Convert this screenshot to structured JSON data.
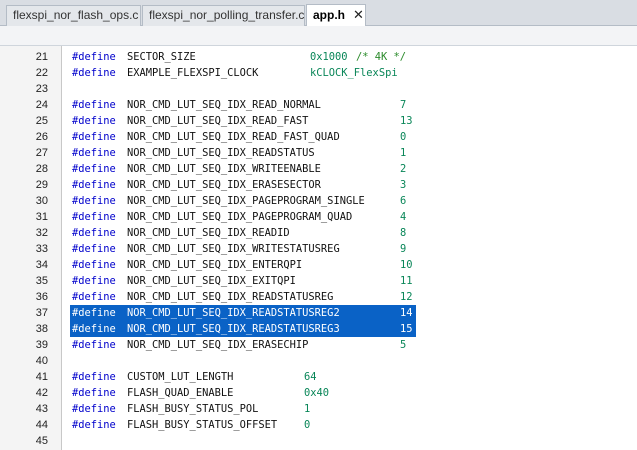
{
  "tabs": [
    {
      "label": "flexspi_nor_flash_ops.c"
    },
    {
      "label": "flexspi_nor_polling_transfer.c"
    },
    {
      "label": "app.h",
      "close": "✕"
    }
  ],
  "code": {
    "lines": [
      {
        "num": "21",
        "kw": "#define",
        "name": "SECTOR_SIZE",
        "value": "0x1000",
        "comment": "/* 4K */"
      },
      {
        "num": "22",
        "kw": "#define",
        "name": "EXAMPLE_FLEXSPI_CLOCK",
        "value": "kCLOCK_FlexSpi"
      },
      {
        "num": "23"
      },
      {
        "num": "24",
        "kw": "#define",
        "name": "NOR_CMD_LUT_SEQ_IDX_READ_NORMAL",
        "value": "7"
      },
      {
        "num": "25",
        "kw": "#define",
        "name": "NOR_CMD_LUT_SEQ_IDX_READ_FAST",
        "value": "13"
      },
      {
        "num": "26",
        "kw": "#define",
        "name": "NOR_CMD_LUT_SEQ_IDX_READ_FAST_QUAD",
        "value": "0"
      },
      {
        "num": "27",
        "kw": "#define",
        "name": "NOR_CMD_LUT_SEQ_IDX_READSTATUS",
        "value": "1"
      },
      {
        "num": "28",
        "kw": "#define",
        "name": "NOR_CMD_LUT_SEQ_IDX_WRITEENABLE",
        "value": "2"
      },
      {
        "num": "29",
        "kw": "#define",
        "name": "NOR_CMD_LUT_SEQ_IDX_ERASESECTOR",
        "value": "3"
      },
      {
        "num": "30",
        "kw": "#define",
        "name": "NOR_CMD_LUT_SEQ_IDX_PAGEPROGRAM_SINGLE",
        "value": "6"
      },
      {
        "num": "31",
        "kw": "#define",
        "name": "NOR_CMD_LUT_SEQ_IDX_PAGEPROGRAM_QUAD",
        "value": "4"
      },
      {
        "num": "32",
        "kw": "#define",
        "name": "NOR_CMD_LUT_SEQ_IDX_READID",
        "value": "8"
      },
      {
        "num": "33",
        "kw": "#define",
        "name": "NOR_CMD_LUT_SEQ_IDX_WRITESTATUSREG",
        "value": "9"
      },
      {
        "num": "34",
        "kw": "#define",
        "name": "NOR_CMD_LUT_SEQ_IDX_ENTERQPI",
        "value": "10"
      },
      {
        "num": "35",
        "kw": "#define",
        "name": "NOR_CMD_LUT_SEQ_IDX_EXITQPI",
        "value": "11"
      },
      {
        "num": "36",
        "kw": "#define",
        "name": "NOR_CMD_LUT_SEQ_IDX_READSTATUSREG",
        "value": "12"
      },
      {
        "num": "37",
        "kw": "#define",
        "name": "NOR_CMD_LUT_SEQ_IDX_READSTATUSREG2",
        "value": "14",
        "selected": true
      },
      {
        "num": "38",
        "kw": "#define",
        "name": "NOR_CMD_LUT_SEQ_IDX_READSTATUSREG3",
        "value": "15",
        "selected": true
      },
      {
        "num": "39",
        "kw": "#define",
        "name": "NOR_CMD_LUT_SEQ_IDX_ERASECHIP",
        "value": "5"
      },
      {
        "num": "40"
      },
      {
        "num": "41",
        "kw": "#define",
        "name": "CUSTOM_LUT_LENGTH",
        "value": "64"
      },
      {
        "num": "42",
        "kw": "#define",
        "name": "FLASH_QUAD_ENABLE",
        "value": "0x40"
      },
      {
        "num": "43",
        "kw": "#define",
        "name": "FLASH_BUSY_STATUS_POL",
        "value": "1"
      },
      {
        "num": "44",
        "kw": "#define",
        "name": "FLASH_BUSY_STATUS_OFFSET",
        "value": "0"
      },
      {
        "num": "45"
      }
    ]
  },
  "colors": {
    "keyword": "#0000cc",
    "value": "#098658",
    "selection": "#0a62c6"
  }
}
